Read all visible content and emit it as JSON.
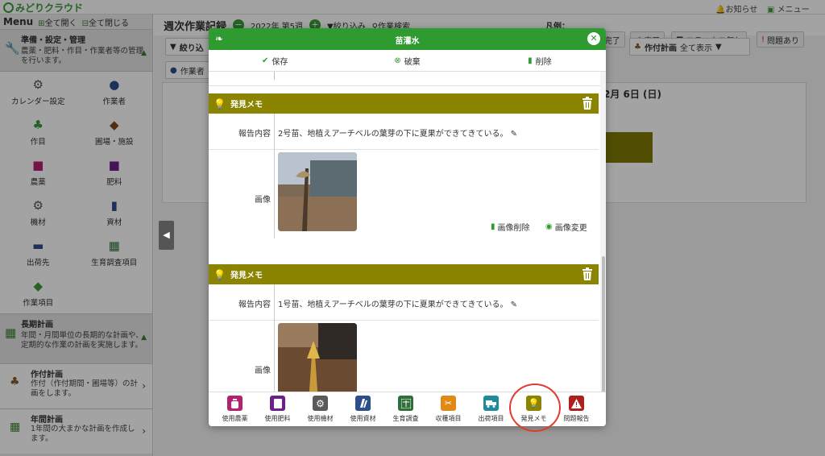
{
  "app": {
    "name": "みどりクラウド",
    "news": "お知らせ",
    "menu": "メニュー"
  },
  "sidebar": {
    "menu_title": "Menu",
    "expand_all": "全て開く",
    "collapse_all": "全て閉じる",
    "setup": {
      "title": "準備・設定・管理",
      "desc": "農薬・肥料・作目・作業者等の管理を行います。"
    },
    "items": [
      {
        "label": "カレンダー設定",
        "icon": "calendar-settings-icon"
      },
      {
        "label": "作業者",
        "icon": "worker-icon"
      },
      {
        "label": "作目",
        "icon": "sprout-icon"
      },
      {
        "label": "圃場・施設",
        "icon": "field-icon"
      },
      {
        "label": "農薬",
        "icon": "pesticide-icon"
      },
      {
        "label": "肥料",
        "icon": "fertilizer-icon"
      },
      {
        "label": "機材",
        "icon": "equipment-icon"
      },
      {
        "label": "資材",
        "icon": "materials-icon"
      },
      {
        "label": "出荷先",
        "icon": "shipping-icon"
      },
      {
        "label": "生育調査項目",
        "icon": "growth-survey-icon"
      },
      {
        "label": "作業項目",
        "icon": "task-item-icon"
      }
    ],
    "longplan": {
      "title": "長期計画",
      "desc": "年間・月間単位の長期的な計画や、定期的な作業の計画を実施します。"
    },
    "sakutsuke": {
      "title": "作付計画",
      "desc": "作付（作付期間・圃場等）の計画をします。"
    },
    "annual": {
      "title": "年間計画",
      "desc": "1年間の大まかな計画を作成します。"
    }
  },
  "header": {
    "title": "週次作業記録",
    "week": "2022年 第5週",
    "filter": "絞り込み",
    "search": "作業検索",
    "legend_label": "凡例：",
    "legend": [
      "未完了",
      "完了",
      "ステータス無し",
      "問題あり"
    ],
    "filter_short": "絞り込",
    "worker_short": "作業者",
    "sakutsuke_plan": "作付計画",
    "show_all": "全て表示",
    "date": "2月 6日 (日)"
  },
  "modal": {
    "title": "苗灌水",
    "save": "保存",
    "discard": "破棄",
    "delete": "削除",
    "memos": [
      {
        "title": "発見メモ",
        "report_label": "報告内容",
        "report": "2号苗、地植えアーチベルの葉芽の下に夏果ができてきている。",
        "image_label": "画像",
        "image_delete": "画像削除",
        "image_change": "画像変更"
      },
      {
        "title": "発見メモ",
        "report_label": "報告内容",
        "report": "1号苗、地植えアーチベルの葉芽の下に夏果ができてきている。",
        "image_label": "画像"
      }
    ],
    "footer": [
      {
        "label": "使用農薬",
        "color": "#b2226e",
        "icon": "pesticide-icon"
      },
      {
        "label": "使用肥料",
        "color": "#6f1f8a",
        "icon": "fertilizer-icon"
      },
      {
        "label": "使用機材",
        "color": "#5a5a5a",
        "icon": "equipment-icon"
      },
      {
        "label": "使用資材",
        "color": "#2c4f8c",
        "icon": "materials-icon"
      },
      {
        "label": "生育調査",
        "color": "#2f6f3a",
        "icon": "growth-survey-icon"
      },
      {
        "label": "収穫項目",
        "color": "#e08a14",
        "icon": "harvest-icon"
      },
      {
        "label": "出荷項目",
        "color": "#1f8a9a",
        "icon": "shipping-icon"
      },
      {
        "label": "発見メモ",
        "color": "#8a8400",
        "icon": "bulb-icon"
      },
      {
        "label": "問題報告",
        "color": "#b01e1e",
        "icon": "warning-icon"
      }
    ]
  },
  "colors": {
    "brand": "#2f9a2f",
    "memo": "#8a8400",
    "highlight": "#e03b2f"
  }
}
